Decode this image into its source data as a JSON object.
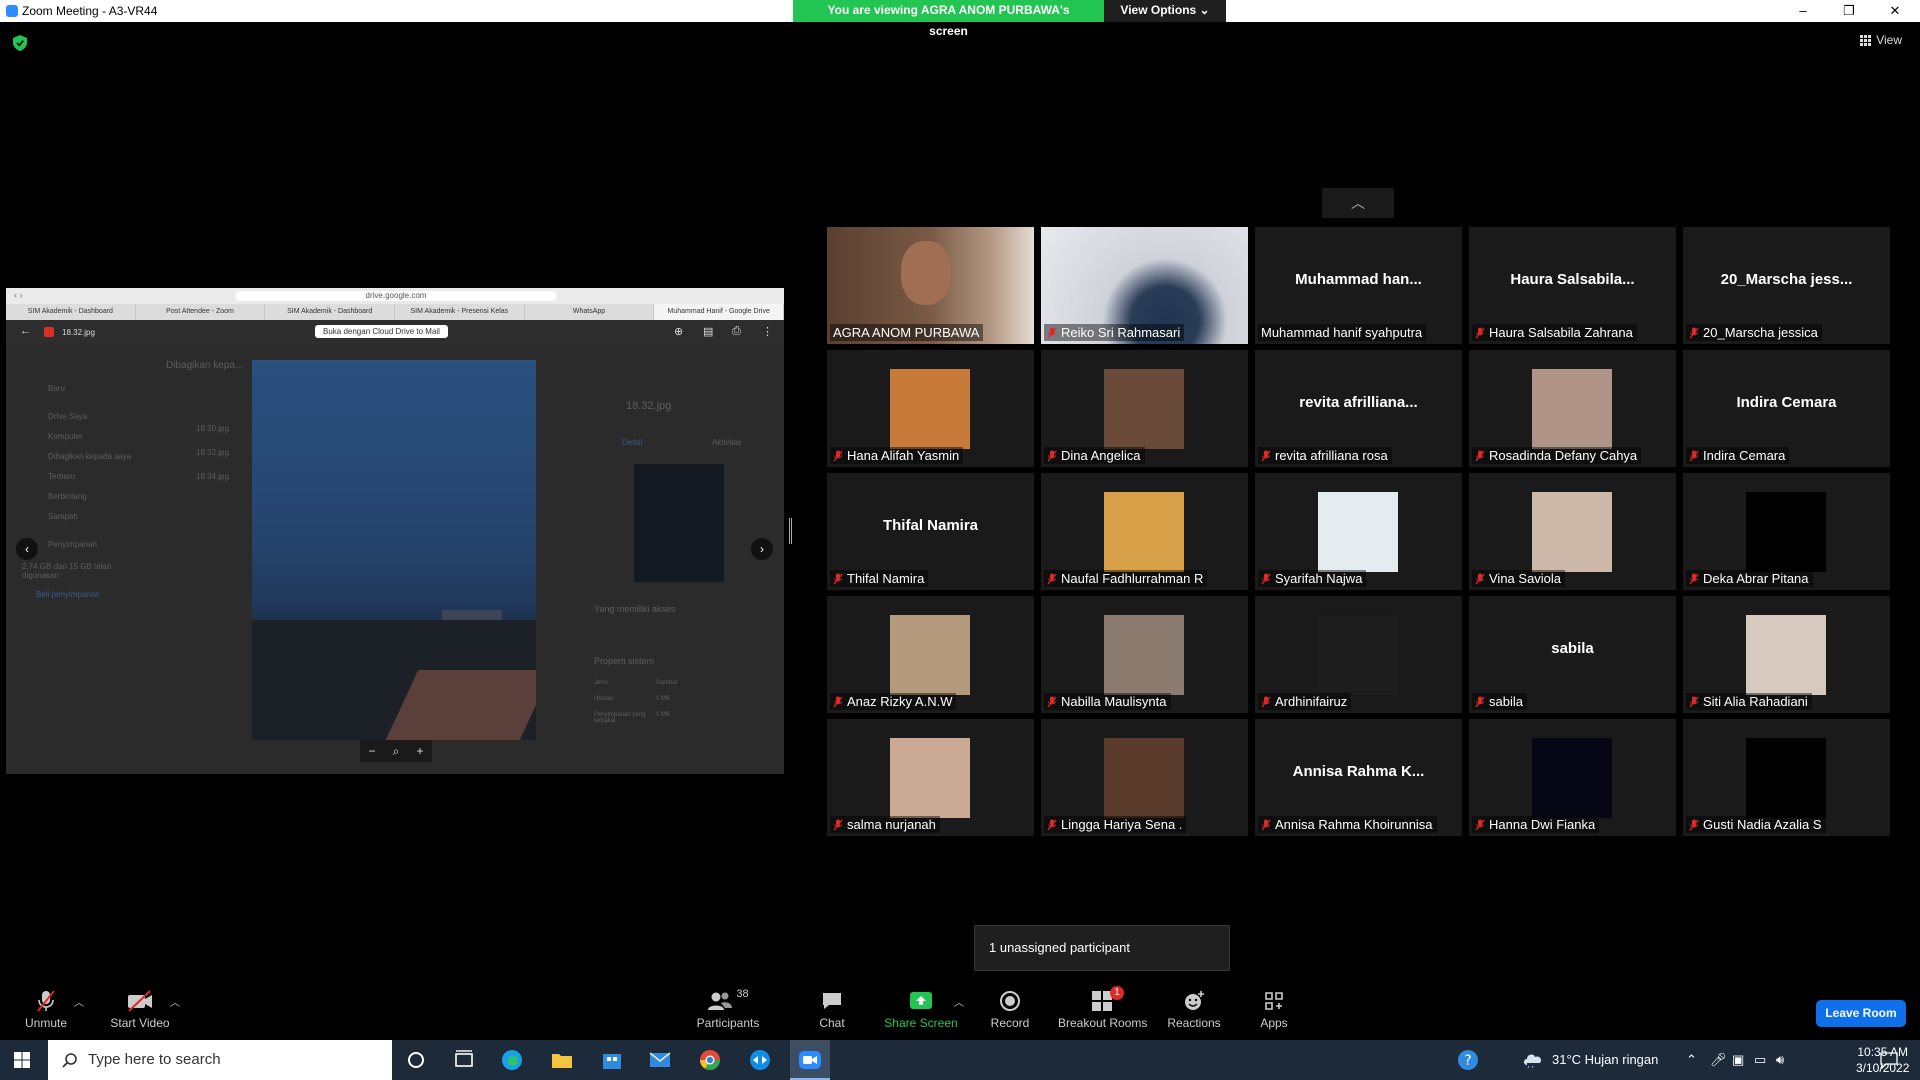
{
  "window": {
    "title": "Zoom Meeting - A3-VR44",
    "min": "–",
    "max": "❐",
    "close": "✕"
  },
  "share_banner": {
    "message": "You are viewing AGRA ANOM PURBAWA's screen",
    "options": "View Options ⌄"
  },
  "view_button": "View",
  "shared_screen": {
    "url": "drive.google.com",
    "tabs": [
      "SIM Akademik - Dashboard",
      "Post Attendee - Zoom",
      "SIM Akademik - Dashboard",
      "SIM Akademik - Presensi Kelas",
      "WhatsApp",
      "Muhammad Hanif - Google Drive"
    ],
    "file_name": "18.32.jpg",
    "open_with": "Buka dengan Cloud Drive to Mail",
    "shared_header": "Dibagikan kepa...",
    "new_button": "Baru",
    "details_title": "18.32.jpg",
    "details_tab": "Detail",
    "activity_tab": "Aktivitas",
    "access_label": "Yang memiliki akses",
    "system_props": "Properti sistem",
    "sidebar": [
      "Drive Saya",
      "Komputer",
      "Dibagikan kepada saya",
      "Terbaru",
      "Berbintang",
      "Sampah",
      "Penyimpanan"
    ],
    "files": [
      "18.30.jpg",
      "18.32.jpg",
      "18.34.jpg"
    ],
    "storage_text": "2,74 GB dari 15 GB telah digunakan",
    "buy_storage": "Beli penyimpanan",
    "props": [
      "Jenis",
      "Gambar",
      "Ukuran",
      "1 MB",
      "Penyimpanan yang terpakai",
      "1 MB"
    ]
  },
  "participants": [
    {
      "name": "AGRA ANOM PURBAWA",
      "kind": "video",
      "muted": false,
      "color": "#6b4a3a"
    },
    {
      "name": "Reiko Sri Rahmasari",
      "kind": "video",
      "muted": true,
      "color": "#cfd2da"
    },
    {
      "name": "Muhammad hanif syahputra",
      "kind": "name",
      "display": "Muhammad  han...",
      "muted": false
    },
    {
      "name": "Haura Salsabila Zahrana",
      "kind": "name",
      "display": "Haura  Salsabila...",
      "muted": true
    },
    {
      "name": "20_Marscha jessica",
      "kind": "name",
      "display": "20_Marscha  jess...",
      "muted": true
    },
    {
      "name": "Hana Alifah Yasmin",
      "kind": "photo",
      "muted": true,
      "color": "#c77a3a"
    },
    {
      "name": "Dina Angelica",
      "kind": "photo",
      "muted": true,
      "color": "#6a4a38"
    },
    {
      "name": "revita afrilliana rosa",
      "kind": "name",
      "display": "revita  afrilliana...",
      "muted": true
    },
    {
      "name": "Rosadinda Defany Cahya",
      "kind": "photo",
      "muted": true,
      "color": "#b09488"
    },
    {
      "name": "Indira Cemara",
      "kind": "name",
      "display": "Indira Cemara",
      "muted": true
    },
    {
      "name": "Thifal Namira",
      "kind": "name",
      "display": "Thifal Namira",
      "muted": true
    },
    {
      "name": "Naufal Fadhlurrahman R",
      "kind": "photo",
      "muted": true,
      "color": "#d8a048"
    },
    {
      "name": "Syarifah Najwa",
      "kind": "photo",
      "muted": true,
      "color": "#e4ecef"
    },
    {
      "name": "Vina Saviola",
      "kind": "photo",
      "muted": true,
      "color": "#cbb8a8"
    },
    {
      "name": "Deka Abrar Pitana",
      "kind": "photo",
      "muted": true,
      "color": "#000000"
    },
    {
      "name": "Anaz Rizky A.N.W",
      "kind": "photo",
      "muted": true,
      "color": "#b49a7c"
    },
    {
      "name": "Nabilla Maulisynta",
      "kind": "photo",
      "muted": true,
      "color": "#8c7c70"
    },
    {
      "name": "Ardhinifairuz",
      "kind": "photo",
      "muted": true,
      "color": "#1d1d1d"
    },
    {
      "name": "sabila",
      "kind": "name",
      "display": "sabila",
      "muted": true
    },
    {
      "name": "Siti Alia Rahadiani",
      "kind": "photo",
      "muted": true,
      "color": "#d6c9c0"
    },
    {
      "name": "salma nurjanah",
      "kind": "photo",
      "muted": true,
      "color": "#c9a894"
    },
    {
      "name": "Lingga Hariya Sena .",
      "kind": "photo",
      "muted": true,
      "color": "#5a3a2a"
    },
    {
      "name": "Annisa Rahma Khoirunnisa",
      "kind": "name",
      "display": "Annisa  Rahma  K...",
      "muted": true
    },
    {
      "name": "Hanna Dwi Fianka",
      "kind": "photo",
      "muted": true,
      "color": "#050814"
    },
    {
      "name": "Gusti Nadia Azalia S",
      "kind": "photo",
      "muted": true,
      "color": "#000000"
    }
  ],
  "unassigned": "1 unassigned participant",
  "toolbar": {
    "unmute": "Unmute",
    "start_video": "Start Video",
    "participants": "Participants",
    "participants_count": "38",
    "chat": "Chat",
    "share_screen": "Share Screen",
    "record": "Record",
    "breakout": "Breakout Rooms",
    "breakout_badge": "1",
    "reactions": "Reactions",
    "apps": "Apps",
    "leave": "Leave Room"
  },
  "taskbar": {
    "search_placeholder": "Type here to search",
    "weather": "31°C  Hujan ringan",
    "time": "10:35 AM",
    "date": "3/10/2022"
  },
  "colors": {
    "green": "#23c552",
    "blue": "#0e71eb",
    "tile": "#1a1a1a",
    "muted_red": "#e02828"
  }
}
